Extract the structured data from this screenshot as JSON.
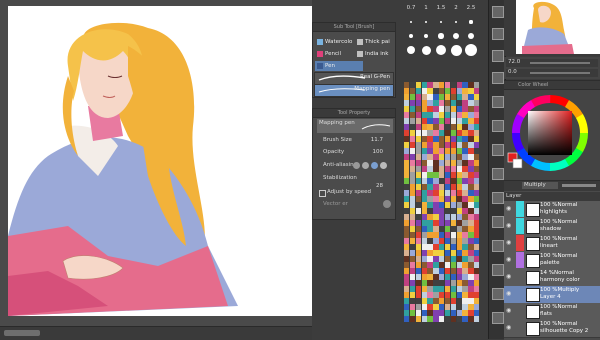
{
  "subtool": {
    "title": "Sub Tool [Brush]",
    "items": [
      {
        "label": "Watercolo",
        "color": "#7ab3e0"
      },
      {
        "label": "Thick pai",
        "color": "#c0c0c0"
      },
      {
        "label": "Pencil",
        "color": "#e0407a"
      },
      {
        "label": "India ink",
        "color": "#c0c0c0"
      },
      {
        "label": "Pen",
        "color": "#5a7fb0"
      }
    ],
    "brushes": [
      "Real G-Pen",
      "Mapping pen"
    ]
  },
  "tool_property": {
    "title": "Tool Property",
    "brush_name": "Mapping pen",
    "brush_size_label": "Brush Size",
    "brush_size_value": "11.7",
    "opacity_label": "Opacity",
    "opacity_value": "100",
    "antialias_label": "Anti-aliasin",
    "stabilization_label": "Stabilization",
    "stabilization_value": "28",
    "adjust_speed_label": "Adjust by speed",
    "vector_label": "Vector er"
  },
  "brush_sizes": [
    "0.7",
    "1",
    "1.5",
    "2",
    "2.5"
  ],
  "navigator": {
    "zoom": "72.0",
    "angle": "0.0"
  },
  "color_wheel": {
    "title": "Color Wheel"
  },
  "layer_panel": {
    "title": "Layer",
    "blend_mode": "Multiply",
    "layers": [
      {
        "line1": "100 %Normal",
        "line2": "highlights",
        "tag": "#3fd8e0",
        "selected": false
      },
      {
        "line1": "100 %Normal",
        "line2": "shadow",
        "tag": "#3fd8e0",
        "selected": false
      },
      {
        "line1": "100 %Normal",
        "line2": "lineart",
        "tag": "#e04040",
        "selected": false
      },
      {
        "line1": "100 %Normal",
        "line2": "palette",
        "tag": "#b070e0",
        "selected": false
      },
      {
        "line1": "14 %Normal",
        "line2": "harmony color",
        "tag": "",
        "selected": false
      },
      {
        "line1": "100 %Multiply",
        "line2": "Layer 4",
        "tag": "",
        "selected": true
      },
      {
        "line1": "100 %Normal",
        "line2": "flats",
        "tag": "",
        "selected": false
      },
      {
        "line1": "100 %Normal",
        "line2": "silhouette Copy 2",
        "tag": "",
        "selected": false
      }
    ]
  }
}
